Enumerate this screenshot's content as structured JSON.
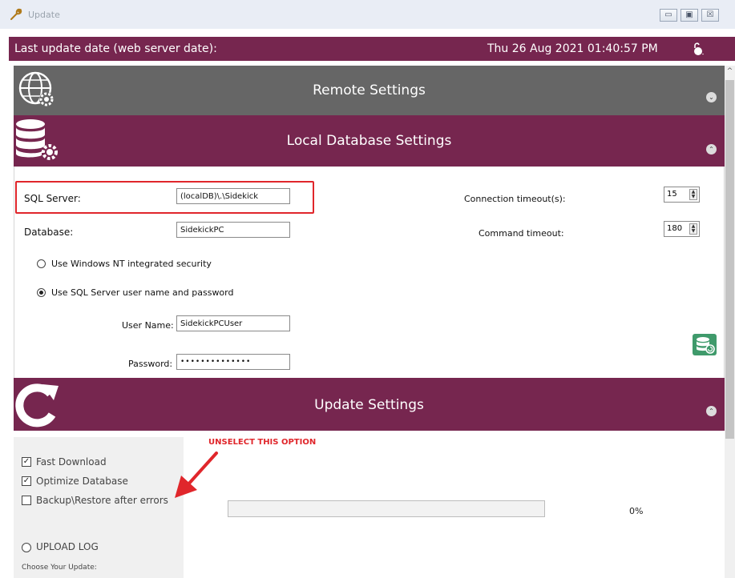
{
  "window": {
    "title": "Update",
    "controls": {
      "minimize": "▭",
      "maximize": "▣",
      "close": "☒"
    }
  },
  "header": {
    "label": "Last update date (web server date):",
    "date": "Thu 26 Aug 2021 01:40:57 PM"
  },
  "sections": {
    "remote": {
      "title": "Remote Settings",
      "icon": "globe-gear-icon",
      "expanded": false
    },
    "local": {
      "title": "Local Database Settings",
      "icon": "database-gear-icon",
      "expanded": true
    },
    "update": {
      "title": "Update Settings",
      "icon": "refresh-icon",
      "expanded": true
    }
  },
  "local_db": {
    "sql_server_label": "SQL Server:",
    "sql_server_value": "(localDB)\\.\\Sidekick",
    "database_label": "Database:",
    "database_value": "SidekickPC",
    "connection_timeout_label": "Connection timeout(s):",
    "connection_timeout_value": "15",
    "command_timeout_label": "Command timeout:",
    "command_timeout_value": "180",
    "auth_windows_label": "Use Windows NT integrated security",
    "auth_sql_label": "Use SQL Server user name and password",
    "selected_auth": "sql",
    "username_label": "User Name:",
    "username_value": "SidekickPCUser",
    "password_label": "Password:",
    "password_value": "••••••••••••••"
  },
  "update": {
    "annotation": "UNSELECT THIS OPTION",
    "options": [
      {
        "label": "Fast Download",
        "checked": true
      },
      {
        "label": "Optimize Database",
        "checked": true
      },
      {
        "label": "Backup\\Restore after errors",
        "checked": false
      }
    ],
    "upload_log_label": "UPLOAD LOG",
    "choose_label": "Choose Your Update:",
    "progress_percent": 0,
    "progress_text": "0%"
  },
  "colors": {
    "accent": "#76264f",
    "collapsed_section": "#666666",
    "highlight": "#e0262b"
  }
}
